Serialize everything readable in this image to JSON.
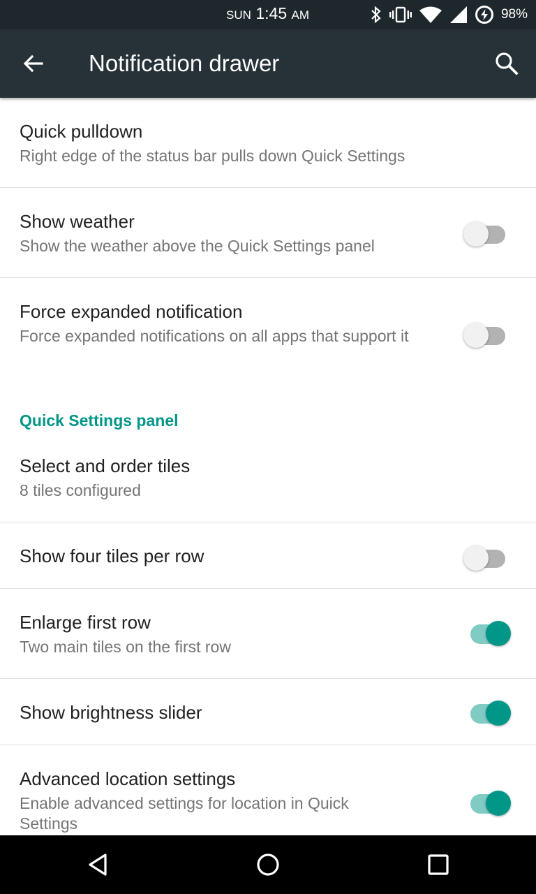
{
  "status_bar": {
    "day": "SUN",
    "time": "1:45",
    "ampm": "AM",
    "battery": "98%",
    "icons": [
      "bluetooth-icon",
      "vibrate-icon",
      "wifi-icon",
      "signal-icon",
      "battery-saver-icon"
    ]
  },
  "toolbar": {
    "title": "Notification drawer",
    "back_icon": "arrow-back-icon",
    "search_icon": "search-icon"
  },
  "prefs": {
    "quick_pulldown": {
      "title": "Quick pulldown",
      "summary": "Right edge of the status bar pulls down Quick Settings"
    },
    "show_weather": {
      "title": "Show weather",
      "summary": "Show the weather above the Quick Settings panel",
      "checked": false
    },
    "force_expanded": {
      "title": "Force expanded notification",
      "summary": "Force expanded notifications on all apps that support it",
      "checked": false
    },
    "section_quick_settings": "Quick Settings panel",
    "select_tiles": {
      "title": "Select and order tiles",
      "summary": "8 tiles configured"
    },
    "four_tiles": {
      "title": "Show four tiles per row",
      "checked": false
    },
    "enlarge_first_row": {
      "title": "Enlarge first row",
      "summary": "Two main tiles on the first row",
      "checked": true
    },
    "brightness_slider": {
      "title": "Show brightness slider",
      "checked": true
    },
    "advanced_location": {
      "title": "Advanced location settings",
      "summary": "Enable advanced settings for location in Quick Settings",
      "checked": true
    }
  },
  "colors": {
    "accent": "#009688",
    "toolbar": "#263238",
    "status_bar": "#1e272b"
  },
  "nav_bar": {
    "back": "nav-back-icon",
    "home": "nav-home-icon",
    "recents": "nav-recents-icon"
  }
}
